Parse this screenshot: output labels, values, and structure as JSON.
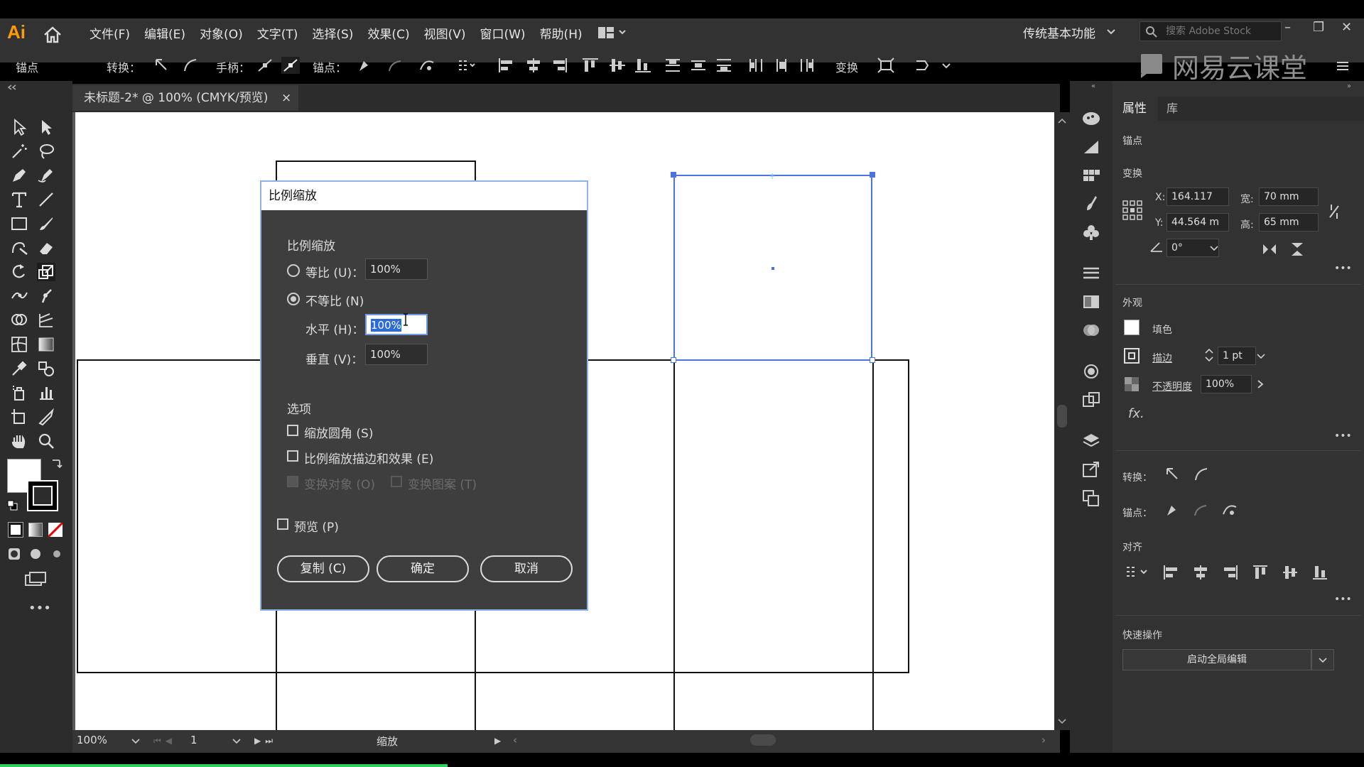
{
  "app": {
    "logo": "Ai"
  },
  "menu": [
    "文件(F)",
    "编辑(E)",
    "对象(O)",
    "文字(T)",
    "选择(S)",
    "效果(C)",
    "视图(V)",
    "窗口(W)",
    "帮助(H)"
  ],
  "workspace": {
    "label": "传统基本功能",
    "search_placeholder": "搜索 Adobe Stock"
  },
  "watermark": "网易云课堂",
  "control_bar": {
    "anchor_label": "锚点",
    "convert_label": "转换：",
    "handle_label": "手柄：",
    "anchors_label": "锚点：",
    "transform_label": "变换"
  },
  "document_tab": {
    "title": "未标题-2* @ 100% (CMYK/预览)",
    "close": "×"
  },
  "status": {
    "zoom": "100%",
    "artboard": "1",
    "tool": "缩放"
  },
  "right_panel": {
    "tabs": [
      "属性",
      "库"
    ],
    "section_anchor": "锚点",
    "section_transform": "变换",
    "x_label": "X:",
    "x_value": "164.117",
    "y_label": "Y:",
    "y_value": "44.564 m",
    "w_label": "宽:",
    "w_value": "70 mm",
    "h_label": "高:",
    "h_value": "65 mm",
    "angle_value": "0°",
    "section_appearance": "外观",
    "fill_label": "填色",
    "stroke_label": "描边",
    "stroke_value": "1 pt",
    "opacity_label": "不透明度",
    "opacity_value": "100%",
    "fx": "fx.",
    "convert_label": "转换：",
    "anchor2_label": "锚点：",
    "align_label": "对齐",
    "quick_label": "快速操作",
    "global_edit": "启动全局编辑"
  },
  "dialog": {
    "title": "比例缩放",
    "section": "比例缩放",
    "uniform_label": "等比 (U)：",
    "uniform_value": "100%",
    "nonuniform_label": "不等比 (N)",
    "horizontal_label": "水平 (H)：",
    "horizontal_value": "100%",
    "vertical_label": "垂直 (V)：",
    "vertical_value": "100%",
    "options_label": "选项",
    "scale_corners": "缩放圆角 (S)",
    "scale_strokes": "比例缩放描边和效果 (E)",
    "transform_objects": "变换对象 (O)",
    "transform_patterns": "变换图案 (T)",
    "preview": "预览 (P)",
    "copy_button": "复制 (C)",
    "ok_button": "确定",
    "cancel_button": "取消"
  }
}
